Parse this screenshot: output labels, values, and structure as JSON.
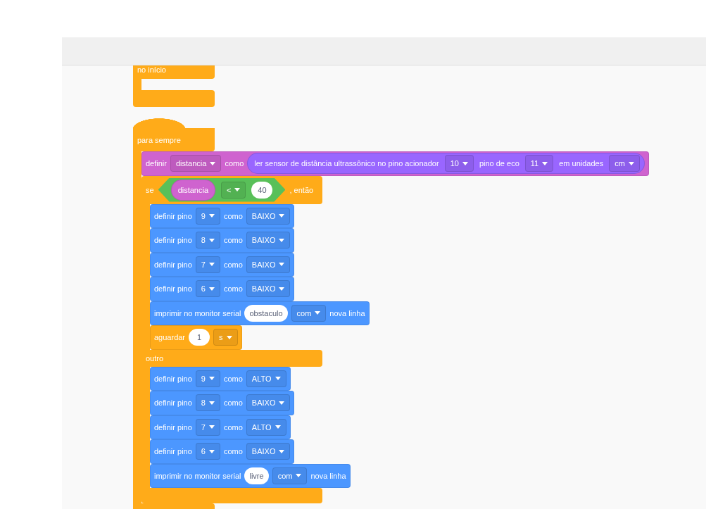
{
  "start_block": {
    "color": "#ffab19",
    "label": "no início"
  },
  "forever_block": {
    "color": "#ffab19",
    "label": "para sempre",
    "body": [
      {
        "kind": "stack",
        "color": "#cf63cf",
        "parts": [
          {
            "kind": "text",
            "text": "definir"
          },
          {
            "kind": "dropdown",
            "text": "distancia"
          },
          {
            "kind": "text",
            "text": "como"
          },
          {
            "kind": "reporter",
            "color": "#9966ff",
            "parts": [
              {
                "kind": "text",
                "text": "ler sensor de distância ultrassônico no pino acionador"
              },
              {
                "kind": "dropdown",
                "text": "10"
              },
              {
                "kind": "text",
                "text": "pino de eco"
              },
              {
                "kind": "dropdown",
                "text": "11"
              },
              {
                "kind": "text",
                "text": "em unidades"
              },
              {
                "kind": "dropdown",
                "text": "cm"
              }
            ]
          }
        ]
      },
      {
        "kind": "if_else",
        "color": "#ffab19",
        "parts": [
          {
            "kind": "text",
            "text": "se"
          },
          {
            "kind": "boolean",
            "color": "#59c059",
            "parts": [
              {
                "kind": "reporter",
                "color": "#cf63cf",
                "parts": [
                  {
                    "kind": "text",
                    "text": "distancia"
                  }
                ]
              },
              {
                "kind": "dropdown",
                "text": "<"
              },
              {
                "kind": "input",
                "text": "40"
              }
            ]
          },
          {
            "kind": "text",
            "text": ", então"
          }
        ],
        "then": [
          {
            "kind": "stack",
            "color": "#4c97ff",
            "parts": [
              {
                "kind": "text",
                "text": "definir pino"
              },
              {
                "kind": "dropdown",
                "text": "9"
              },
              {
                "kind": "text",
                "text": "como"
              },
              {
                "kind": "dropdown",
                "text": "BAIXO"
              }
            ]
          },
          {
            "kind": "stack",
            "color": "#4c97ff",
            "parts": [
              {
                "kind": "text",
                "text": "definir pino"
              },
              {
                "kind": "dropdown",
                "text": "8"
              },
              {
                "kind": "text",
                "text": "como"
              },
              {
                "kind": "dropdown",
                "text": "BAIXO"
              }
            ]
          },
          {
            "kind": "stack",
            "color": "#4c97ff",
            "parts": [
              {
                "kind": "text",
                "text": "definir pino"
              },
              {
                "kind": "dropdown",
                "text": "7"
              },
              {
                "kind": "text",
                "text": "como"
              },
              {
                "kind": "dropdown",
                "text": "BAIXO"
              }
            ]
          },
          {
            "kind": "stack",
            "color": "#4c97ff",
            "parts": [
              {
                "kind": "text",
                "text": "definir pino"
              },
              {
                "kind": "dropdown",
                "text": "6"
              },
              {
                "kind": "text",
                "text": "como"
              },
              {
                "kind": "dropdown",
                "text": "BAIXO"
              }
            ]
          },
          {
            "kind": "stack",
            "color": "#4c97ff",
            "parts": [
              {
                "kind": "text",
                "text": "imprimir no monitor serial"
              },
              {
                "kind": "input",
                "text": "obstaculo"
              },
              {
                "kind": "dropdown",
                "text": "com"
              },
              {
                "kind": "text",
                "text": "nova linha"
              }
            ]
          },
          {
            "kind": "stack",
            "color": "#ffab19",
            "parts": [
              {
                "kind": "text",
                "text": "aguardar"
              },
              {
                "kind": "input",
                "text": "1"
              },
              {
                "kind": "dropdown",
                "text": "s"
              }
            ]
          }
        ],
        "else_label": "outro",
        "else": [
          {
            "kind": "stack",
            "color": "#4c97ff",
            "parts": [
              {
                "kind": "text",
                "text": "definir pino"
              },
              {
                "kind": "dropdown",
                "text": "9"
              },
              {
                "kind": "text",
                "text": "como"
              },
              {
                "kind": "dropdown",
                "text": "ALTO"
              }
            ]
          },
          {
            "kind": "stack",
            "color": "#4c97ff",
            "parts": [
              {
                "kind": "text",
                "text": "definir pino"
              },
              {
                "kind": "dropdown",
                "text": "8"
              },
              {
                "kind": "text",
                "text": "como"
              },
              {
                "kind": "dropdown",
                "text": "BAIXO"
              }
            ]
          },
          {
            "kind": "stack",
            "color": "#4c97ff",
            "parts": [
              {
                "kind": "text",
                "text": "definir pino"
              },
              {
                "kind": "dropdown",
                "text": "7"
              },
              {
                "kind": "text",
                "text": "como"
              },
              {
                "kind": "dropdown",
                "text": "ALTO"
              }
            ]
          },
          {
            "kind": "stack",
            "color": "#4c97ff",
            "parts": [
              {
                "kind": "text",
                "text": "definir pino"
              },
              {
                "kind": "dropdown",
                "text": "6"
              },
              {
                "kind": "text",
                "text": "como"
              },
              {
                "kind": "dropdown",
                "text": "BAIXO"
              }
            ]
          },
          {
            "kind": "stack",
            "color": "#4c97ff",
            "parts": [
              {
                "kind": "text",
                "text": "imprimir no monitor serial"
              },
              {
                "kind": "input",
                "text": "livre"
              },
              {
                "kind": "dropdown",
                "text": "com"
              },
              {
                "kind": "text",
                "text": "nova linha"
              }
            ]
          }
        ]
      }
    ]
  }
}
